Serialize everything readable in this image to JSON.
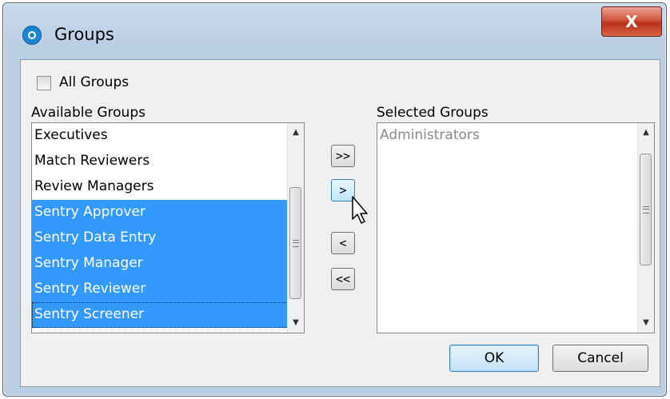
{
  "window": {
    "title": "Groups",
    "close_label": "X"
  },
  "all_groups": {
    "label": "All Groups",
    "checked": false
  },
  "available": {
    "label": "Available Groups",
    "items": [
      {
        "label": "Executives",
        "selected": false
      },
      {
        "label": "Match Reviewers",
        "selected": false
      },
      {
        "label": "Review Managers",
        "selected": false
      },
      {
        "label": "Sentry Approver",
        "selected": true
      },
      {
        "label": "Sentry Data Entry",
        "selected": true
      },
      {
        "label": "Sentry Manager",
        "selected": true
      },
      {
        "label": "Sentry Reviewer",
        "selected": true
      },
      {
        "label": "Sentry Screener",
        "selected": true
      }
    ]
  },
  "selected": {
    "label": "Selected Groups",
    "items": [
      {
        "label": "Administrators",
        "selected": false
      }
    ]
  },
  "move_buttons": {
    "add_all": ">>",
    "add": ">",
    "remove": "<",
    "remove_all": "<<"
  },
  "buttons": {
    "ok": "OK",
    "cancel": "Cancel"
  },
  "icons": {
    "app": "app-logo-icon",
    "close": "close-icon",
    "cursor": "mouse-pointer-icon",
    "scroll_up": "scroll-up-arrow-icon",
    "scroll_down": "scroll-down-arrow-icon"
  },
  "colors": {
    "selection": "#3399ff",
    "close_button": "#c7422b",
    "window_frame": "#b9cde3",
    "disabled_text": "#8a8a8a"
  }
}
